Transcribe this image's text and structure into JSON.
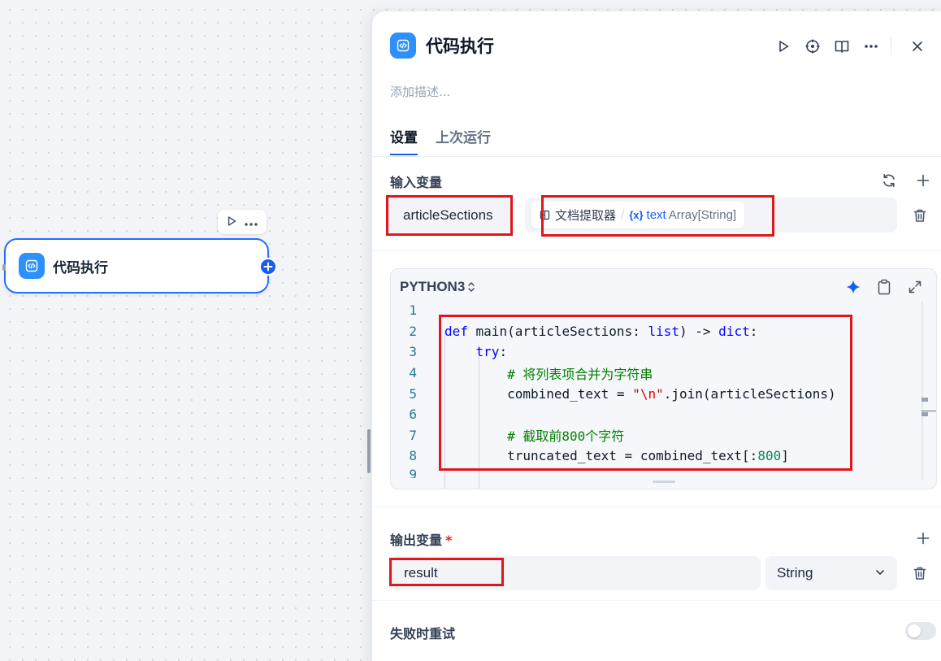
{
  "canvas": {
    "node": {
      "title": "代码执行",
      "icon": "code-icon",
      "add_icon": "plus-icon",
      "toolbar": {
        "run_icon": "play-icon",
        "more_icon": "more-icon"
      }
    }
  },
  "panel": {
    "title": "代码执行",
    "icon": "code-icon",
    "actions": [
      "play-icon",
      "crosshair-icon",
      "book-icon",
      "more-icon",
      "close-icon"
    ],
    "description_placeholder": "添加描述...",
    "tabs": [
      {
        "label": "设置",
        "active": true
      },
      {
        "label": "上次运行",
        "active": false
      }
    ],
    "input_section": {
      "title": "输入变量",
      "variables": [
        {
          "name": "articleSections",
          "source_node": "文档提取器",
          "separator": "/",
          "var_symbol": "{x}",
          "var_name": "text",
          "var_type": "Array[String]"
        }
      ]
    },
    "code": {
      "language": "PYTHON3",
      "language_arrow": "⌃⌄",
      "lines": [
        {
          "n": "1",
          "text": ""
        },
        {
          "n": "2",
          "text": "def main(articleSections: list) -> dict:"
        },
        {
          "n": "3",
          "text": "    try:"
        },
        {
          "n": "4",
          "text": "        # 将列表项合并为字符串"
        },
        {
          "n": "5",
          "text": "        combined_text = \"\\n\".join(articleSections)"
        },
        {
          "n": "6",
          "text": ""
        },
        {
          "n": "7",
          "text": "        # 截取前800个字符"
        },
        {
          "n": "8",
          "text": "        truncated_text = combined_text[:800]"
        },
        {
          "n": "9",
          "text": ""
        }
      ]
    },
    "output_section": {
      "title": "输出变量",
      "required_mark": "*",
      "variables": [
        {
          "name": "result",
          "type": "String"
        }
      ]
    },
    "retry_section": {
      "title": "失败时重试",
      "enabled": false
    }
  },
  "colors": {
    "accent": "#155eef",
    "node_icon": "#2e90fa",
    "highlight": "#e4141b"
  }
}
